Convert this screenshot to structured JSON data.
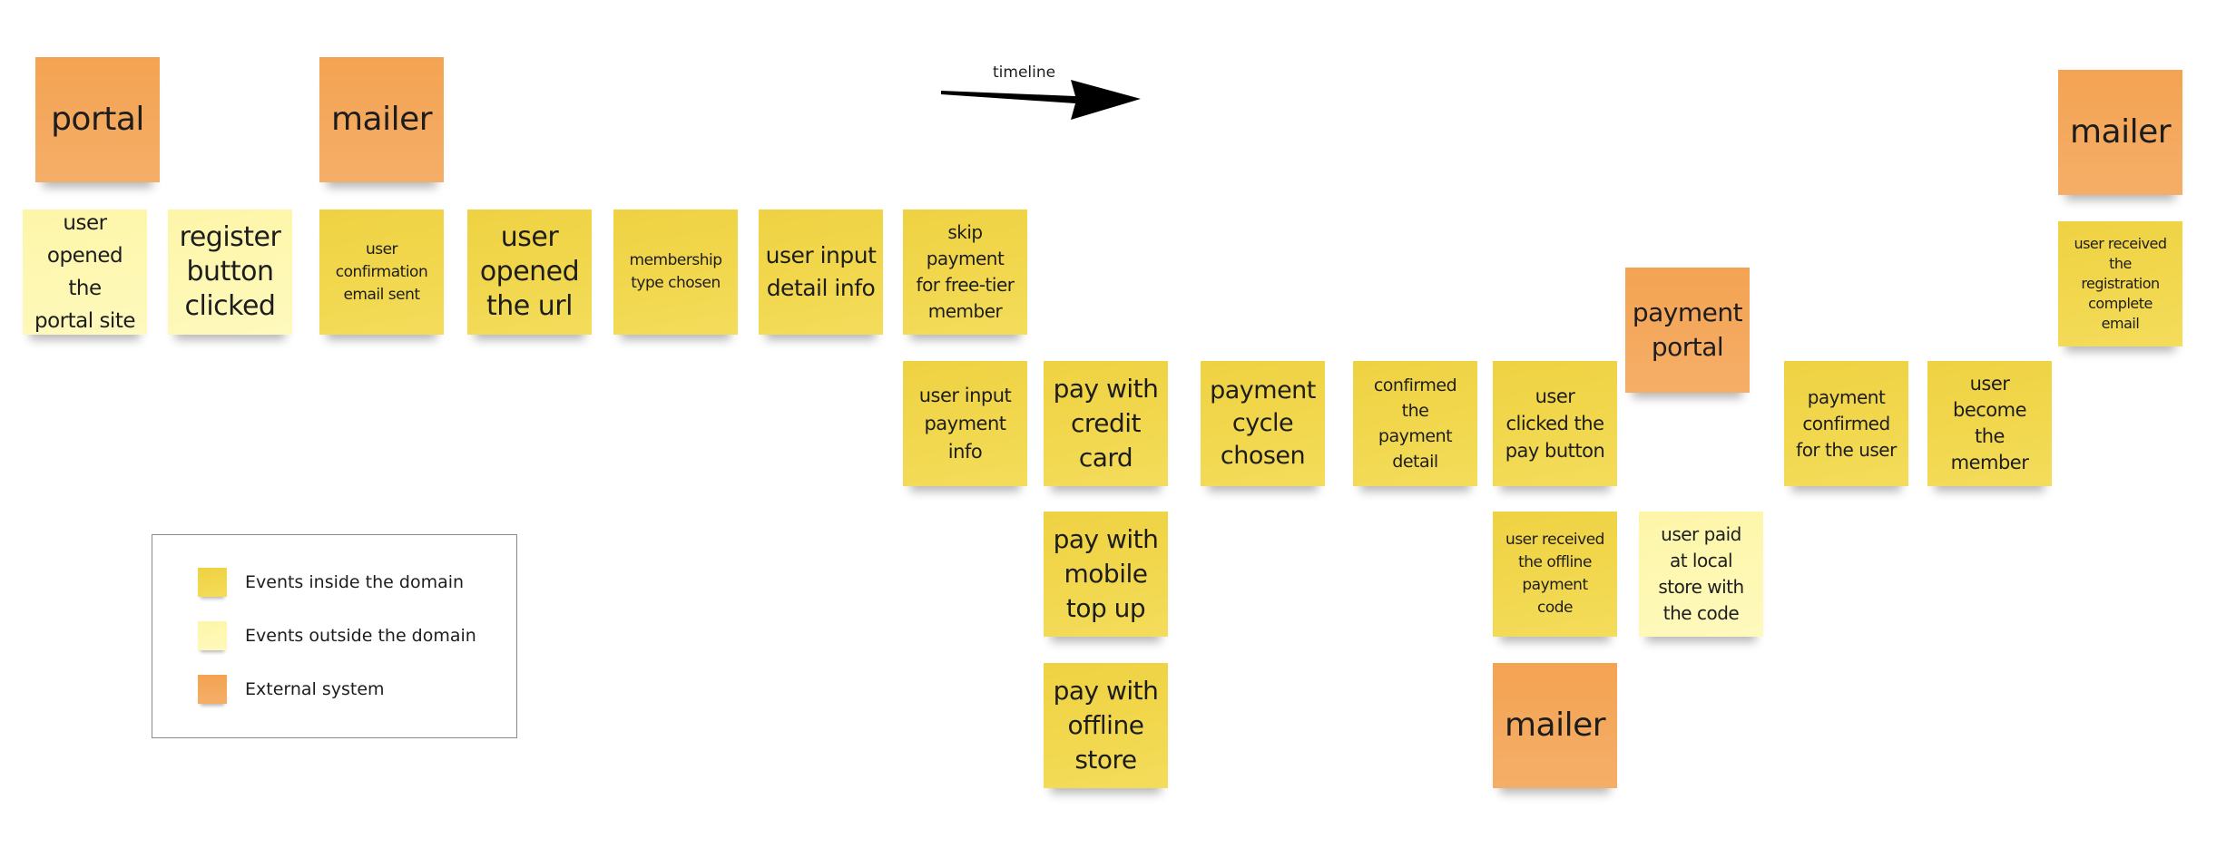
{
  "timeline": {
    "label": "timeline"
  },
  "colors": {
    "inside": "#f2d64b",
    "outside": "#fdf7b0",
    "external": "#f4a55a"
  },
  "notes": [
    {
      "text": "portal",
      "kind": "external"
    },
    {
      "text": "mailer",
      "kind": "external"
    },
    {
      "text": "mailer",
      "kind": "external"
    },
    {
      "text": "user\nopened the\nportal site",
      "kind": "outside"
    },
    {
      "text": "register\nbutton\nclicked",
      "kind": "outside"
    },
    {
      "text": "user\nconfirmation\nemail sent",
      "kind": "inside"
    },
    {
      "text": "user\nopened\nthe url",
      "kind": "inside"
    },
    {
      "text": "membership\ntype chosen",
      "kind": "inside"
    },
    {
      "text": "user input\ndetail info",
      "kind": "inside"
    },
    {
      "text": "skip\npayment\nfor free-tier\nmember",
      "kind": "inside"
    },
    {
      "text": "user input\npayment\ninfo",
      "kind": "inside"
    },
    {
      "text": "pay with\ncredit\ncard",
      "kind": "inside"
    },
    {
      "text": "pay with\nmobile\ntop up",
      "kind": "inside"
    },
    {
      "text": "pay with\noffline\nstore",
      "kind": "inside"
    },
    {
      "text": "payment\ncycle\nchosen",
      "kind": "inside"
    },
    {
      "text": "confirmed\nthe\npayment\ndetail",
      "kind": "inside"
    },
    {
      "text": "user\nclicked the\npay button",
      "kind": "inside"
    },
    {
      "text": "payment\nportal",
      "kind": "external"
    },
    {
      "text": "user received\nthe offline\npayment\ncode",
      "kind": "inside"
    },
    {
      "text": "user paid\nat local\nstore with\nthe code",
      "kind": "outside"
    },
    {
      "text": "mailer",
      "kind": "external"
    },
    {
      "text": "payment\nconfirmed\nfor the user",
      "kind": "inside"
    },
    {
      "text": "user\nbecome\nthe\nmember",
      "kind": "inside"
    },
    {
      "text": "user received\nthe\nregistration\ncomplete\nemail",
      "kind": "inside"
    }
  ],
  "legend": {
    "items": [
      {
        "label": "Events inside the domain",
        "kind": "inside"
      },
      {
        "label": "Events outside the domain",
        "kind": "outside"
      },
      {
        "label": "External system",
        "kind": "external"
      }
    ]
  }
}
